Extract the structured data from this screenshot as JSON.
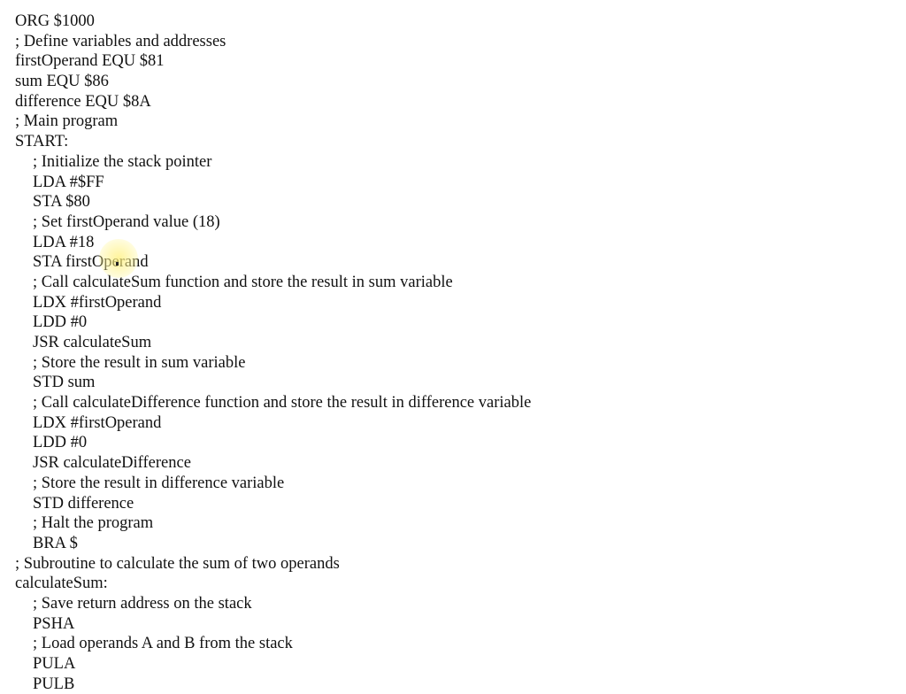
{
  "document": {
    "lines": [
      {
        "text": "ORG $1000",
        "indent": 0
      },
      {
        "text": "; Define variables and addresses",
        "indent": 0
      },
      {
        "text": "firstOperand EQU $81",
        "indent": 0
      },
      {
        "text": "sum EQU $86",
        "indent": 0
      },
      {
        "text": "difference EQU $8A",
        "indent": 0
      },
      {
        "text": "; Main program",
        "indent": 0
      },
      {
        "text": "START:",
        "indent": 0
      },
      {
        "text": "; Initialize the stack pointer",
        "indent": 1
      },
      {
        "text": "LDA #$FF",
        "indent": 1
      },
      {
        "text": "STA $80",
        "indent": 1
      },
      {
        "text": "; Set firstOperand value (18)",
        "indent": 1
      },
      {
        "text": "LDA #18",
        "indent": 1
      },
      {
        "text": "STA firstOperand",
        "indent": 1
      },
      {
        "text": "; Call calculateSum function and store the result in sum variable",
        "indent": 1
      },
      {
        "text": "LDX #firstOperand",
        "indent": 1
      },
      {
        "text": "LDD #0",
        "indent": 1
      },
      {
        "text": "JSR calculateSum",
        "indent": 1
      },
      {
        "text": "; Store the result in sum variable",
        "indent": 1
      },
      {
        "text": "STD sum",
        "indent": 1
      },
      {
        "text": "; Call calculateDifference function and store the result in difference variable",
        "indent": 1
      },
      {
        "text": "LDX #firstOperand",
        "indent": 1
      },
      {
        "text": "LDD #0",
        "indent": 1
      },
      {
        "text": "JSR calculateDifference",
        "indent": 1
      },
      {
        "text": "; Store the result in difference variable",
        "indent": 1
      },
      {
        "text": "STD difference",
        "indent": 1
      },
      {
        "text": "; Halt the program",
        "indent": 1
      },
      {
        "text": "BRA $",
        "indent": 1
      },
      {
        "text": "; Subroutine to calculate the sum of two operands",
        "indent": 0
      },
      {
        "text": "calculateSum:",
        "indent": 0
      },
      {
        "text": "; Save return address on the stack",
        "indent": 1
      },
      {
        "text": "PSHA",
        "indent": 1
      },
      {
        "text": "; Load operands A and B from the stack",
        "indent": 1
      },
      {
        "text": "PULA",
        "indent": 1
      },
      {
        "text": "PULB",
        "indent": 1
      }
    ]
  }
}
